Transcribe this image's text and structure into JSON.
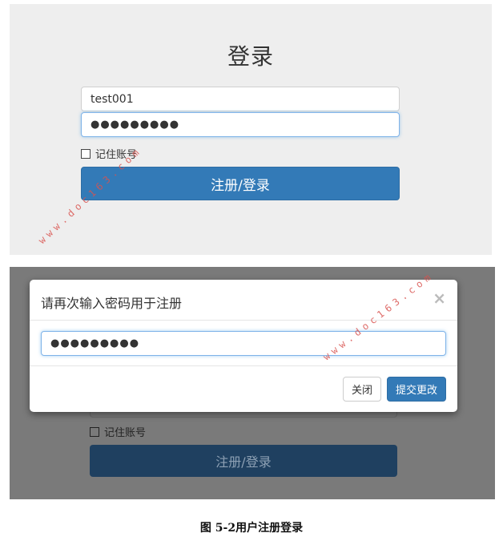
{
  "login_form": {
    "title": "登录",
    "username_value": "test001",
    "password_value": "●●●●●●●●●",
    "remember_label": "记住账号",
    "submit_label": "注册/登录"
  },
  "modal": {
    "title": "请再次输入密码用于注册",
    "close_glyph": "×",
    "password_value": "●●●●●●●●●",
    "cancel_label": "关闭",
    "submit_label": "提交更改"
  },
  "background_form": {
    "remember_label": "记住账号",
    "submit_label": "注册/登录"
  },
  "watermark": "www.doc163.com",
  "caption": "图 5-2用户注册登录",
  "colors": {
    "primary": "#337ab7",
    "panel_bg": "#eeeeee",
    "overlay_bg": "#7a7a7a",
    "watermark": "#d9534f"
  }
}
